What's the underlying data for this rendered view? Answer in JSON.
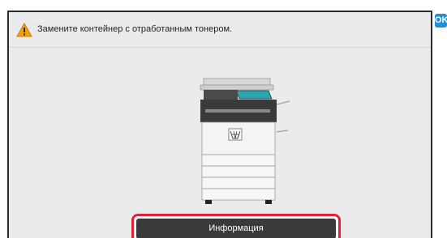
{
  "alert": {
    "message": "Замените контейнер с отработанным тонером.",
    "icon": "warning-icon",
    "icon_color": "#f2a10f"
  },
  "controls": {
    "ok_label": "OK",
    "ok_color": "#1f8fd8",
    "info_label": "Информация",
    "info_highlight_color": "#e0213a"
  },
  "illustration": {
    "icon": "printer-illustration",
    "accent_color": "#2aa6b0"
  }
}
